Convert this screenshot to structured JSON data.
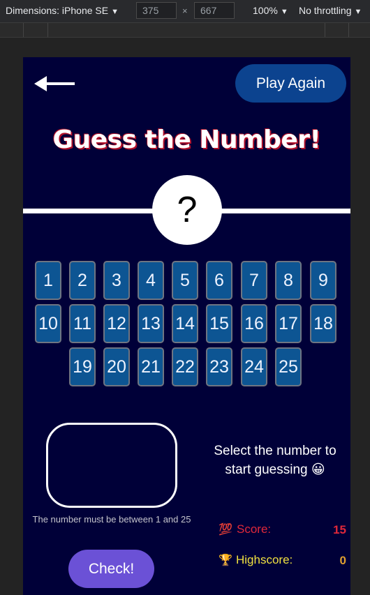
{
  "devtools": {
    "dimensions_label": "Dimensions: iPhone SE",
    "width_value": "375",
    "height_value": "667",
    "times": "×",
    "zoom": "100%",
    "throttle": "No throttling",
    "caret": "▼"
  },
  "header": {
    "play_again_label": "Play Again"
  },
  "game": {
    "title": "Guess the Number!",
    "mystery": "?",
    "numbers": [
      [
        "1",
        "2",
        "3",
        "4",
        "5",
        "6",
        "7",
        "8",
        "9"
      ],
      [
        "10",
        "11",
        "12",
        "13",
        "14",
        "15",
        "16",
        "17",
        "18"
      ],
      [
        "19",
        "20",
        "21",
        "22",
        "23",
        "24",
        "25"
      ]
    ],
    "hint": "The number must be between 1 and 25",
    "check_label": "Check!",
    "message": "Select the number to start guessing 😀"
  },
  "stats": {
    "score_icon": "💯",
    "score_label": "Score:",
    "score_value": "15",
    "highscore_icon": "🏆",
    "highscore_label": "Highscore:",
    "highscore_value": "0"
  },
  "colors": {
    "background": "#000038",
    "tile": "#0d5593",
    "play_again": "#0c438f",
    "check": "#6b51d6",
    "score": "#e0283a",
    "highscore": "#f0e040",
    "highscore_value": "#e0a030",
    "title_shadow": "#b0102a"
  }
}
